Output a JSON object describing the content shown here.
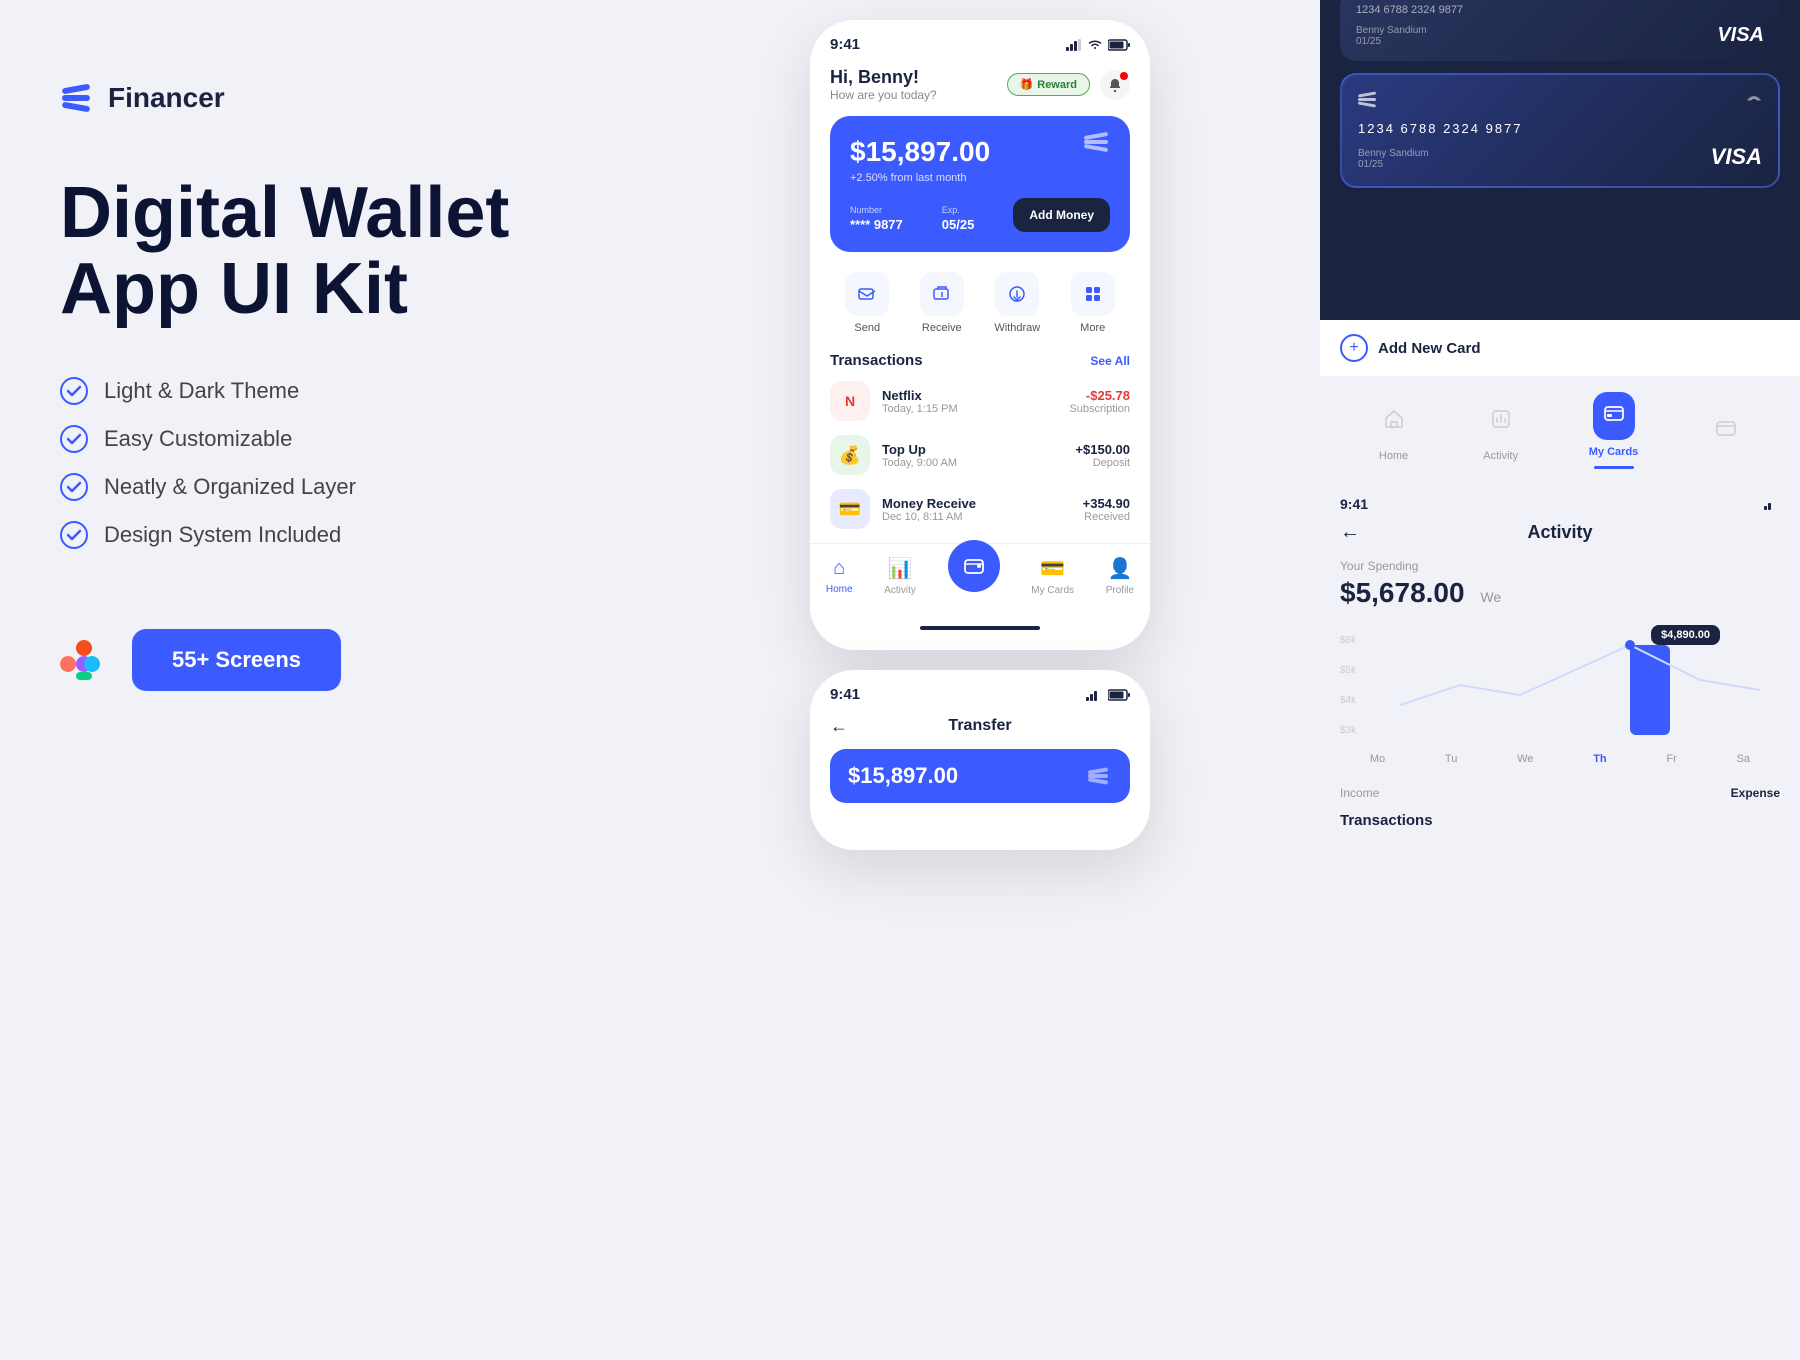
{
  "logo": {
    "text": "Financer"
  },
  "headline": {
    "line1": "Digital Wallet",
    "line2": "App UI Kit"
  },
  "features": [
    "Light & Dark Theme",
    "Easy Customizable",
    "Neatly & Organized Layer",
    "Design System Included"
  ],
  "cta": {
    "screens_label": "55+ Screens"
  },
  "phone1": {
    "status_time": "9:41",
    "greeting_name": "Hi, Benny!",
    "greeting_sub": "How are you today?",
    "reward_label": "Reward",
    "balance": "$15,897.00",
    "balance_change": "+2.50% from last month",
    "card_number_label": "Number",
    "card_number": "**** 9877",
    "card_exp_label": "Exp.",
    "card_exp": "05/25",
    "add_money_label": "Add Money",
    "actions": [
      {
        "icon": "📤",
        "label": "Send"
      },
      {
        "icon": "📥",
        "label": "Receive"
      },
      {
        "icon": "⬇️",
        "label": "Withdraw"
      },
      {
        "icon": "⠿",
        "label": "More"
      }
    ],
    "transactions_title": "Transactions",
    "see_all": "See All",
    "transactions": [
      {
        "name": "Netflix",
        "date": "Today, 1:15 PM",
        "amount": "-$25.78",
        "type": "Subscription",
        "positive": false,
        "icon": "N"
      },
      {
        "name": "Top Up",
        "date": "Today, 9:00 AM",
        "amount": "+$150.00",
        "type": "Deposit",
        "positive": true,
        "icon": "💰"
      },
      {
        "name": "Money Receive",
        "date": "Dec 10, 8:11 AM",
        "amount": "+354.90",
        "type": "Received",
        "positive": true,
        "icon": "💳"
      }
    ],
    "nav_items": [
      "Home",
      "Activity",
      "My Cards",
      "Profile"
    ]
  },
  "phone2": {
    "status_time": "9:41",
    "transfer_title": "Transfer",
    "transfer_amount": "$15,897.00"
  },
  "right_cards": {
    "card1": {
      "number": "1234  6788  2324  9877",
      "name": "Benny Sandium",
      "expiry": "01/25",
      "brand": "VISA"
    },
    "card2": {
      "number": "1234  6788  2324  9877",
      "name": "Benny Sandium",
      "expiry": "01/25",
      "brand": "VISA"
    },
    "add_new_card": "Add New Card",
    "my_cards_label": "My Cards"
  },
  "activity": {
    "status_time": "9:41",
    "title": "Activity",
    "spending_label": "Your Spending",
    "spending_amount": "$5,678.00",
    "chart_tooltip": "$4,890.00",
    "days": [
      "Mo",
      "Tu",
      "We",
      "Th",
      "Fr",
      "Sa"
    ],
    "active_day": "Th",
    "income_label": "Income",
    "expense_label": "Expense",
    "transactions_label": "Transactions"
  },
  "tabs": [
    {
      "label": "Home",
      "icon": "🏠"
    },
    {
      "label": "Activity",
      "icon": "📊"
    },
    {
      "label": "My Cards",
      "icon": "💳"
    },
    {
      "label": "",
      "icon": ""
    }
  ]
}
